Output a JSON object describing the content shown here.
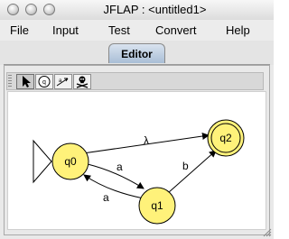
{
  "window": {
    "title": "JFLAP : <untitled1>"
  },
  "menu": {
    "items": [
      "File",
      "Input",
      "Test",
      "Convert",
      "Help"
    ]
  },
  "tabs": {
    "active": "Editor"
  },
  "toolbar": {
    "tools": [
      "arrow-pointer-tool",
      "state-creator-tool",
      "transition-creator-tool",
      "deleter-tool"
    ],
    "selected": 0
  },
  "automaton": {
    "states": [
      {
        "id": "q0",
        "initial": true,
        "final": false
      },
      {
        "id": "q1",
        "initial": false,
        "final": false
      },
      {
        "id": "q2",
        "initial": false,
        "final": true
      }
    ],
    "transitions": [
      {
        "from": "q0",
        "to": "q2",
        "label": "λ"
      },
      {
        "from": "q0",
        "to": "q1",
        "label": "a"
      },
      {
        "from": "q1",
        "to": "q0",
        "label": "a"
      },
      {
        "from": "q1",
        "to": "q2",
        "label": "b"
      }
    ]
  },
  "colors": {
    "state_fill": "#fff27a",
    "tab_active": "#a9bed6"
  }
}
